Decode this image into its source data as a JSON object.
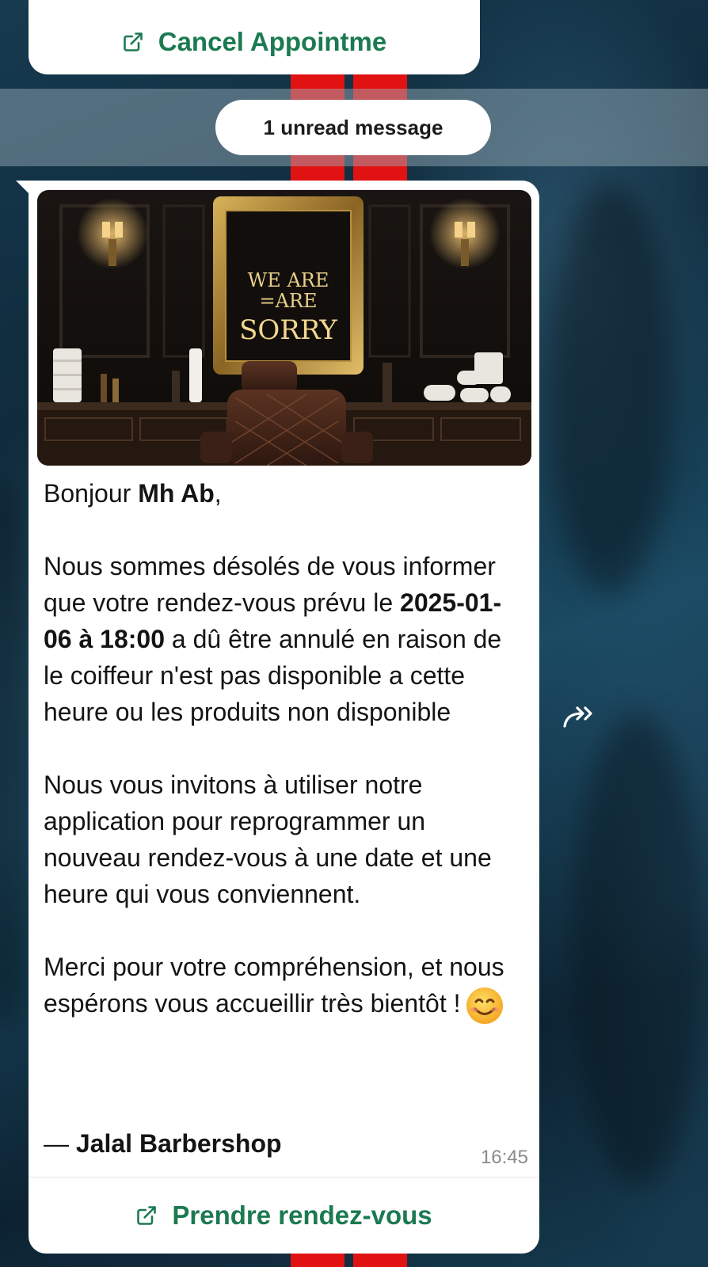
{
  "top_card": {
    "button_label": "Cancel Appointme",
    "icon": "external-link-icon"
  },
  "unread_banner": {
    "label": "1 unread message"
  },
  "message": {
    "image_text": {
      "line1": "WE ARE",
      "line2": "=ARE",
      "line3": "SORRY"
    },
    "greeting_prefix": "Bonjour ",
    "greeting_name": "Mh Ab",
    "greeting_suffix": ",",
    "para1_part1": "Nous sommes désolés de vous informer que votre rendez-vous prévu le ",
    "para1_bold": "2025-01-06 à 18:00",
    "para1_part2": " a dû être annulé en raison de le coiffeur n'est pas disponible a cette heure ou les produits non disponible",
    "para2": "Nous vous invitons à utiliser notre application pour reprogrammer un nouveau rendez-vous à une date et une heure qui vous conviennent.",
    "para3": "Merci pour votre compréhension, et nous espérons vous accueillir très bientôt !",
    "emoji": "smiling-face-icon",
    "signature_dash": "— ",
    "signature_name": "Jalal Barbershop",
    "timestamp": "16:45",
    "action_label": "Prendre rendez-vous",
    "action_icon": "external-link-icon"
  },
  "forward_icon": "forward-icon",
  "colors": {
    "accent_green": "#1c7a51",
    "bubble_bg": "#ffffff",
    "stripe_red": "#e11212",
    "timestamp_gray": "#8a8a8a"
  }
}
